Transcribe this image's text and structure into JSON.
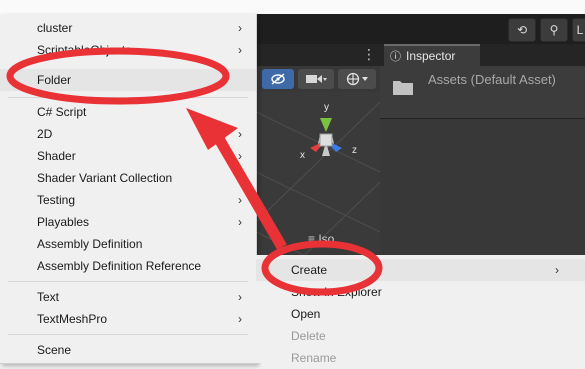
{
  "colors": {
    "annotation_red": "#e83236",
    "unity_dark": "#383838",
    "menu_bg": "#f0f0f0",
    "active_tool_blue": "#3e6aa8"
  },
  "create_submenu": {
    "items": [
      {
        "label": "cluster",
        "has_submenu": true
      },
      {
        "label": "ScriptableObjects",
        "has_submenu": true
      },
      {
        "label": "Folder",
        "has_submenu": false,
        "highlighted": true
      },
      {
        "label": "C# Script",
        "has_submenu": false
      },
      {
        "label": "2D",
        "has_submenu": true
      },
      {
        "label": "Shader",
        "has_submenu": true
      },
      {
        "label": "Shader Variant Collection",
        "has_submenu": false
      },
      {
        "label": "Testing",
        "has_submenu": true
      },
      {
        "label": "Playables",
        "has_submenu": true
      },
      {
        "label": "Assembly Definition",
        "has_submenu": false
      },
      {
        "label": "Assembly Definition Reference",
        "has_submenu": false
      },
      {
        "label": "Text",
        "has_submenu": true
      },
      {
        "label": "TextMeshPro",
        "has_submenu": true
      },
      {
        "label": "Scene",
        "has_submenu": false
      }
    ]
  },
  "context_menu": {
    "items": [
      {
        "label": "Create",
        "has_submenu": true,
        "highlighted": true
      },
      {
        "label": "Show in Explorer",
        "has_submenu": false
      },
      {
        "label": "Open",
        "has_submenu": false
      },
      {
        "label": "Delete",
        "has_submenu": false,
        "disabled": true
      },
      {
        "label": "Rename",
        "has_submenu": false,
        "disabled": true
      }
    ]
  },
  "inspector": {
    "tab_label": "Inspector",
    "title": "Assets (Default Asset)"
  },
  "scene_view": {
    "projection_label": "≡ Iso",
    "axis_x": "x",
    "axis_y": "y",
    "axis_z": "z"
  },
  "glyphs": {
    "arrow": "›",
    "more": "⋮",
    "history": "⟲",
    "search": "⚲",
    "layers": "L",
    "inspector_icon": "ⓘ"
  }
}
